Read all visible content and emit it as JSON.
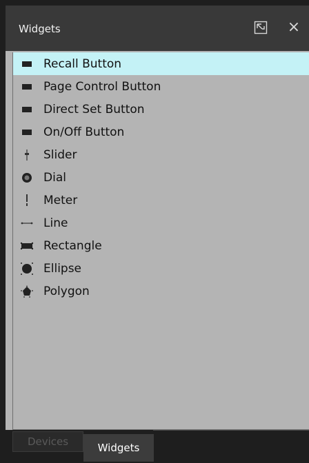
{
  "panel": {
    "title": "Widgets",
    "float_icon": "undock-icon",
    "close_label": "×"
  },
  "widgets": [
    {
      "label": "Recall Button",
      "icon": "button-icon",
      "selected": true
    },
    {
      "label": "Page Control Button",
      "icon": "button-icon"
    },
    {
      "label": "Direct Set Button",
      "icon": "button-icon"
    },
    {
      "label": "On/Off Button",
      "icon": "button-icon"
    },
    {
      "label": "Slider",
      "icon": "slider-icon"
    },
    {
      "label": "Dial",
      "icon": "dial-icon"
    },
    {
      "label": "Meter",
      "icon": "meter-icon"
    },
    {
      "label": "Line",
      "icon": "line-icon"
    },
    {
      "label": "Rectangle",
      "icon": "rectangle-icon"
    },
    {
      "label": "Ellipse",
      "icon": "ellipse-icon"
    },
    {
      "label": "Polygon",
      "icon": "polygon-icon"
    }
  ],
  "tabs": [
    {
      "label": "Devices",
      "active": false
    },
    {
      "label": "Widgets",
      "active": true
    }
  ],
  "colors": {
    "selection": "#c4f2f6",
    "panel_bg": "#b4b4b4",
    "titlebar_bg": "#393939"
  }
}
